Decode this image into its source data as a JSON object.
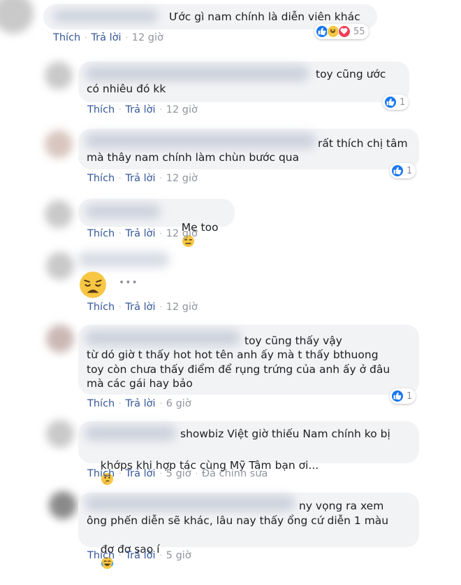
{
  "labels": {
    "like": "Thích",
    "reply": "Trả lời",
    "edited": "Đã chỉnh sửa"
  },
  "comments": [
    {
      "text": "Ước gì nam chính là diễn viên khác",
      "time": "12 giờ",
      "reactions": "55"
    },
    {
      "text_l1": "toy cũng ước",
      "text_l2": "có nhiêu đó kk",
      "time": "12 giờ",
      "reactions": "1"
    },
    {
      "text_l1": "rất thích chị tâm",
      "text_l2": "mà thây nam chính làm chùn bước qua",
      "time": "12 giờ",
      "reactions": "1"
    },
    {
      "text": "Me too",
      "time": "12 giờ"
    },
    {
      "time": "12 giờ"
    },
    {
      "text_l1": "toy cũng thấy vậy",
      "text_l2": "từ dó giờ t thấy hot hot tên anh ấy mà t thấy bthuong",
      "text_l3": "toy còn chưa thấy điểm để rụng trứng của anh ấy ở đâu",
      "text_l4": "mà các gái hay bảo",
      "time": "6 giờ",
      "reactions": "1"
    },
    {
      "text_l1": "showbiz Việt giờ thiếu Nam chính ko bị",
      "text_l2": "khớps khi hợp tác cùng Mỹ Tâm bạn ơi...",
      "time": "5 giờ"
    },
    {
      "text_l1": "ny vọng ra xem",
      "text_l2": "ông phến diễn sẽ khác, lâu nay thấy ổng cứ diễn 1 màu",
      "text_l3": "đơ đơ sao í",
      "time": "5 giờ"
    }
  ],
  "icons": {
    "like": "like-icon",
    "haha": "haha-icon",
    "love": "love-icon",
    "weary": "weary-emoji",
    "expressionless": "expressionless-emoji",
    "thinking": "thinking-emoji",
    "joy": "joy-emoji"
  },
  "colors": {
    "link": "#365899",
    "meta": "#90949c",
    "bubble": "#f2f3f5",
    "like": "#1877f2"
  }
}
